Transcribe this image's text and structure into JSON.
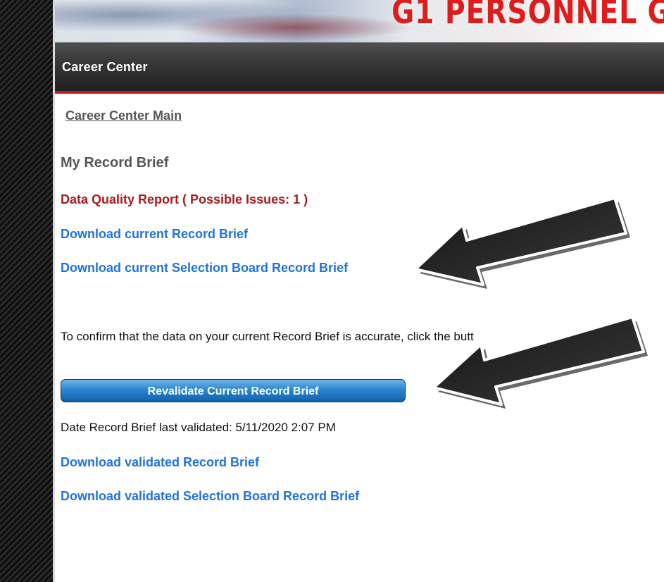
{
  "banner": {
    "title": "G1 PERSONNEL G"
  },
  "nav": {
    "title": "Career Center"
  },
  "breadcrumb": {
    "label": "Career Center Main"
  },
  "record_brief": {
    "title": "My Record Brief",
    "data_quality_report": "Data Quality Report ( Possible Issues: 1 )",
    "download_current": "Download current Record Brief",
    "download_current_selection": "Download current Selection Board Record Brief",
    "instruction": "To confirm that the data on your current Record Brief is accurate, click the butt",
    "revalidate_button": "Revalidate Current Record Brief",
    "last_validated": "Date Record Brief last validated: 5/11/2020 2:07 PM",
    "download_validated": "Download validated Record Brief",
    "download_validated_selection": "Download validated Selection Board Record Brief"
  },
  "colors": {
    "link_blue": "#1f73df",
    "alert_red": "#a61d1d",
    "nav_dark": "#2b2b2b",
    "accent_red": "#c41a1a",
    "button_blue": "#2d86cc"
  }
}
